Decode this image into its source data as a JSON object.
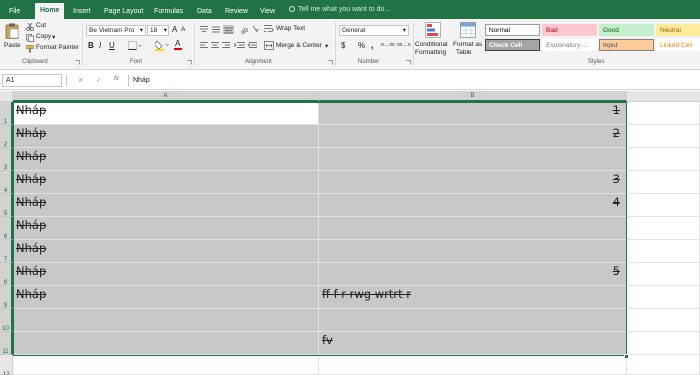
{
  "tabs": [
    "File",
    "Home",
    "Insert",
    "Page Layout",
    "Formulas",
    "Data",
    "Review",
    "View"
  ],
  "tell_me": "Tell me what you want to do...",
  "clipboard": {
    "paste": "Paste",
    "cut": "Cut",
    "copy": "Copy",
    "copy_arrow": "▾",
    "format_painter": "Format Painter",
    "group": "Clipboard"
  },
  "font": {
    "name": "Be Vietnam Pro",
    "size": "18",
    "grow": "A",
    "shrink": "A",
    "bold": "B",
    "italic": "I",
    "underline": "U",
    "font_color_glyph": "A",
    "group": "Font"
  },
  "alignment": {
    "wrap_text": "Wrap Text",
    "merge_center": "Merge & Center",
    "merge_arrow": "▾",
    "group": "Alignment"
  },
  "number": {
    "format": "General",
    "currency": "$",
    "percent": "%",
    "comma": ",",
    "inc_decimal": ".0→.00",
    "dec_decimal": ".00→.0",
    "group": "Number"
  },
  "styles": {
    "conditional": "Conditional",
    "conditional_2": "Formatting",
    "format_as": "Format as",
    "format_as_2": "Table",
    "group": "Styles",
    "cells": [
      {
        "label": "Normal",
        "bg": "#ffffff",
        "fg": "#000000",
        "border": "#9c9c9c"
      },
      {
        "label": "Bad",
        "bg": "#ffc7ce",
        "fg": "#9c0006",
        "border": "#ffc7ce"
      },
      {
        "label": "Good",
        "bg": "#c6efce",
        "fg": "#006100",
        "border": "#c6efce"
      },
      {
        "label": "Neutral",
        "bg": "#ffeb9c",
        "fg": "#9c6500",
        "border": "#ffeb9c"
      },
      {
        "label": "Check Cell",
        "bg": "#a5a5a5",
        "fg": "#ffffff",
        "border": "#3f3f3f"
      },
      {
        "label": "Explanatory ...",
        "bg": "#ffffff",
        "fg": "#7f7f7f",
        "border": "#ffffff"
      },
      {
        "label": "Input",
        "bg": "#ffcc99",
        "fg": "#3f3f76",
        "border": "#7f7f7f"
      },
      {
        "label": "Linked Cell",
        "bg": "#ffffff",
        "fg": "#fa7d00",
        "border": "#ffffff"
      }
    ]
  },
  "formula_bar": {
    "name_box": "A1",
    "cancel": "✕",
    "enter": "✓",
    "fx": "fx",
    "content": "Nháp"
  },
  "sheet": {
    "columns": [
      "A",
      "B"
    ],
    "rows": [
      {
        "n": "1",
        "a": "Nháp",
        "b": "1"
      },
      {
        "n": "2",
        "a": "Nháp",
        "b": "2"
      },
      {
        "n": "3",
        "a": "Nháp",
        "b": ""
      },
      {
        "n": "4",
        "a": "Nháp",
        "b": "3"
      },
      {
        "n": "5",
        "a": "Nháp",
        "b": "4"
      },
      {
        "n": "6",
        "a": "Nháp",
        "b": ""
      },
      {
        "n": "7",
        "a": "Nháp",
        "b": ""
      },
      {
        "n": "8",
        "a": "Nháp",
        "b": "5"
      },
      {
        "n": "9",
        "a": "Nháp",
        "b": "ff f r rwg wrtrt r"
      },
      {
        "n": "10",
        "a": "",
        "b": ""
      },
      {
        "n": "11",
        "a": "",
        "b": "fv"
      },
      {
        "n": "12",
        "a": "",
        "b": ""
      }
    ]
  },
  "colors": {
    "accent": "#217346",
    "selection_fill": "#c8c8c8"
  }
}
